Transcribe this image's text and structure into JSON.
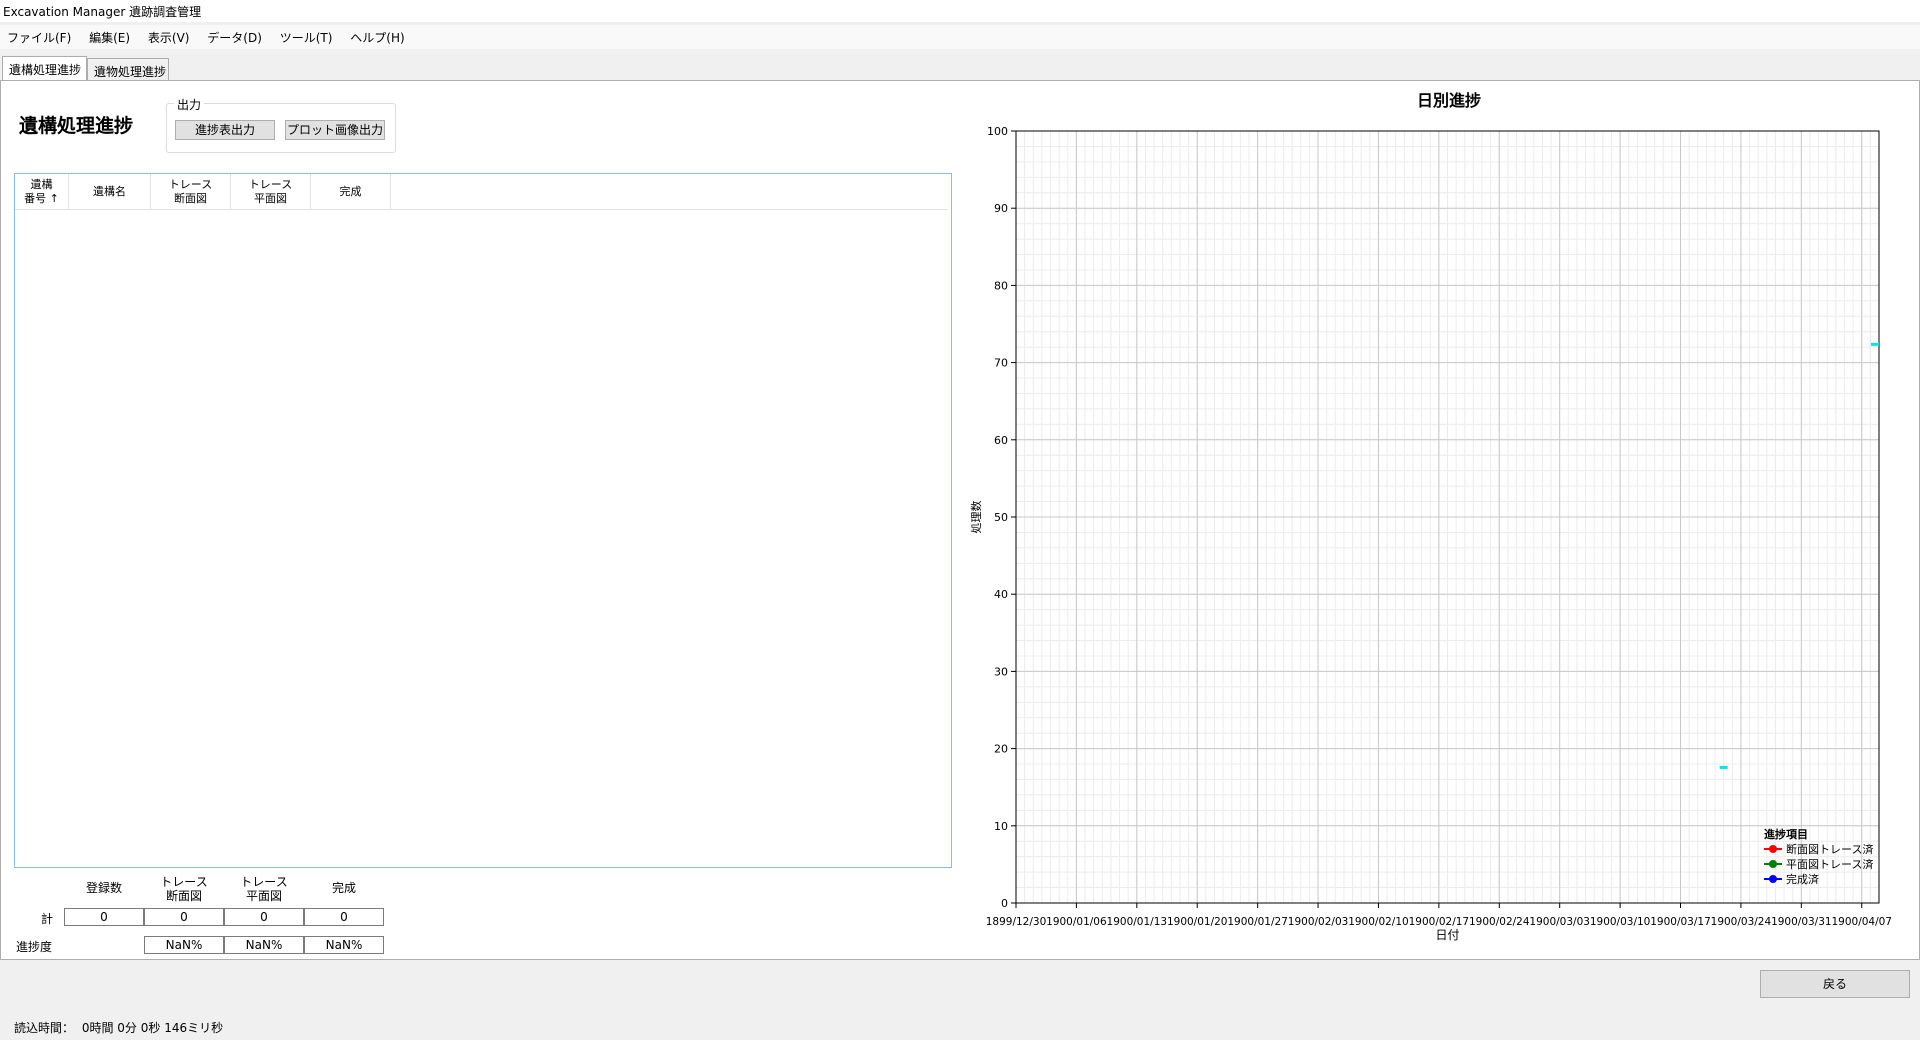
{
  "window": {
    "title": "Excavation Manager 遺跡調査管理"
  },
  "menu": [
    "ファイル(F)",
    "編集(E)",
    "表示(V)",
    "データ(D)",
    "ツール(T)",
    "ヘルプ(H)"
  ],
  "tabs": [
    {
      "label": "遺構処理進捗",
      "active": true
    },
    {
      "label": "遺物処理進捗",
      "active": false
    }
  ],
  "page": {
    "title": "遺構処理進捗"
  },
  "output_group": {
    "label": "出力",
    "progress_table_button": "進捗表出力",
    "plot_image_button": "プロット画像出力"
  },
  "grid": {
    "columns": [
      "遺構\n番号 ↑",
      "遺構名",
      "トレース\n断面図",
      "トレース\n平面図",
      "完成"
    ],
    "rows": []
  },
  "summary": {
    "headers": [
      "登録数",
      "トレース\n断面図",
      "トレース\n平面図",
      "完成"
    ],
    "total_label": "計",
    "totals": [
      "0",
      "0",
      "0",
      "0"
    ],
    "progress_label": "進捗度",
    "progress": [
      "NaN%",
      "NaN%",
      "NaN%"
    ]
  },
  "back_button": "戻る",
  "status": {
    "label": "読込時間：",
    "value": "0時間 0分 0秒 146ミリ秒"
  },
  "chart_data": {
    "type": "line",
    "title": "日別進捗",
    "xlabel": "日付",
    "ylabel": "処理数",
    "x_ticks": [
      "1899/12/30",
      "1900/01/06",
      "1900/01/13",
      "1900/01/20",
      "1900/01/27",
      "1900/02/03",
      "1900/02/10",
      "1900/02/17",
      "1900/02/24",
      "1900/03/03",
      "1900/03/10",
      "1900/03/17",
      "1900/03/24",
      "1900/03/31",
      "1900/04/07"
    ],
    "xlim": [
      "1899/12/30",
      "1900/04/09"
    ],
    "ylim": [
      0,
      100
    ],
    "y_ticks": [
      0,
      10,
      20,
      30,
      40,
      50,
      60,
      70,
      80,
      90,
      100
    ],
    "grid": true,
    "legend": {
      "title": "進捗項目",
      "position": "bottom-right",
      "entries": [
        {
          "name": "断面図トレース済",
          "color": "#ff0000"
        },
        {
          "name": "平面図トレース済",
          "color": "#008000"
        },
        {
          "name": "完成済",
          "color": "#0000ff"
        }
      ]
    },
    "markers": [
      {
        "x": "1900/03/22",
        "y": 17.5,
        "color": "#00e5e5"
      },
      {
        "x": "1900/04/09",
        "y": 72.3,
        "color": "#00e5e5"
      }
    ],
    "series": []
  }
}
